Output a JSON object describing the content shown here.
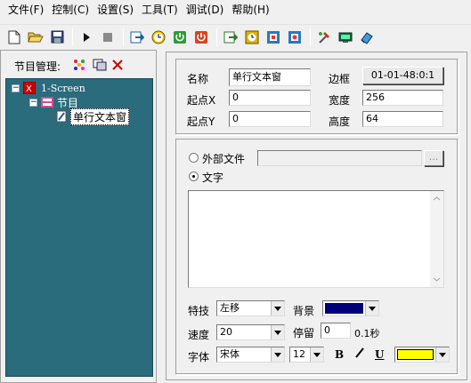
{
  "menu": {
    "items": [
      "文件(F)",
      "控制(C)",
      "设置(S)",
      "工具(T)",
      "调试(D)",
      "帮助(H)"
    ]
  },
  "program_panel": {
    "title": "节目管理:",
    "tree": {
      "screen": "1-Screen",
      "program": "节目",
      "item": "单行文本窗"
    }
  },
  "properties": {
    "name_label": "名称",
    "name_value": "单行文本窗",
    "border_label": "边框",
    "border_value": "01-01-48:0:1",
    "x_label": "起点X",
    "x_value": "0",
    "width_label": "宽度",
    "width_value": "256",
    "y_label": "起点Y",
    "y_value": "0",
    "height_label": "高度",
    "height_value": "64"
  },
  "content": {
    "external_file_label": "外部文件",
    "external_file_value": "",
    "browse_label": "...",
    "text_label": "文字",
    "text_value": "",
    "selected_source": "文字"
  },
  "effects": {
    "effect_label": "特技",
    "effect_value": "左移",
    "background_label": "背景",
    "background_color": "#00007a",
    "speed_label": "速度",
    "speed_value": "20",
    "stay_label": "停留",
    "stay_value": "0",
    "stay_unit": "0.1秒",
    "font_label": "字体",
    "font_value": "宋体",
    "font_size_value": "12",
    "bold_label": "B",
    "italic_label": "I",
    "underline_label": "U",
    "font_color": "#ffff00"
  },
  "toolbar_icons": [
    "new-icon",
    "open-icon",
    "save-icon",
    "play-icon",
    "stop-icon",
    "send-icon",
    "clock-icon",
    "power-on-icon",
    "power-off-icon",
    "send-program-icon",
    "timer-icon",
    "brightness-icon",
    "brightness-schedule-icon",
    "tools-icon",
    "display-icon",
    "clear-icon"
  ]
}
